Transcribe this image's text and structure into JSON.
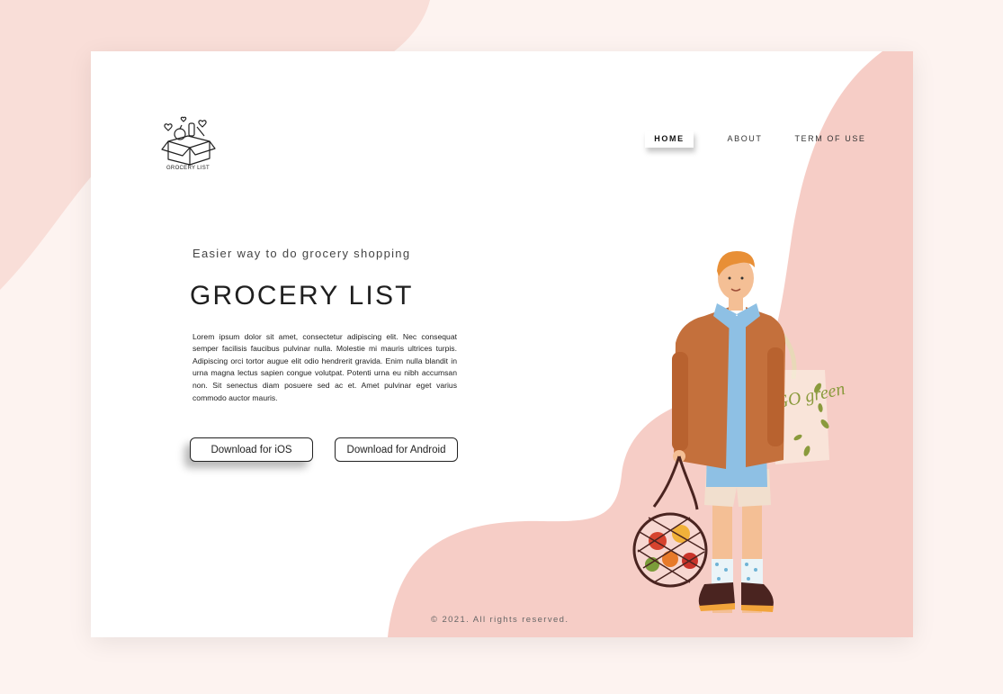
{
  "brand": {
    "logo_text": "GROCERY LIST"
  },
  "nav": {
    "home": "HOME",
    "about": "ABOUT",
    "terms": "TERM OF USE"
  },
  "hero": {
    "tagline": "Easier way to do grocery shopping",
    "title": "GROCERY LIST",
    "description": "Lorem ipsum dolor sit amet, consectetur adipiscing elit. Nec consequat semper facilisis faucibus pulvinar nulla. Molestie mi mauris ultrices turpis. Adipiscing orci tortor augue elit odio hendrerit gravida. Enim nulla blandit in urna magna lectus sapien congue volutpat. Potenti urna eu nibh accumsan non. Sit senectus diam posuere sed ac et. Amet pulvinar eget varius commodo auctor mauris."
  },
  "buttons": {
    "ios": "Download for iOS",
    "android": "Download for Android"
  },
  "footer": {
    "copyright": "© 2021. All rights reserved."
  },
  "illustration": {
    "bag_text": "GO green"
  },
  "colors": {
    "accent_pink": "#f6cdc6",
    "background": "#fdf3f0",
    "text_dark": "#1f1f1f"
  },
  "icons": {
    "logo": "grocery-box-icon"
  }
}
